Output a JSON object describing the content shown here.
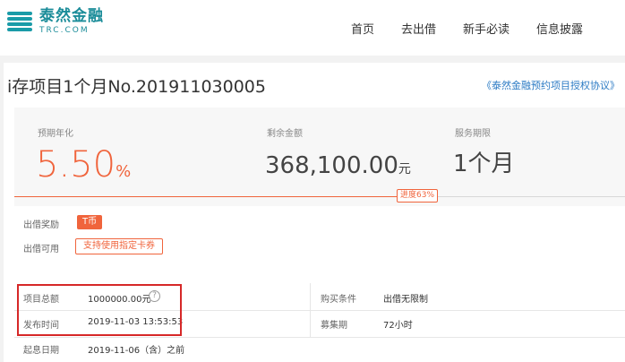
{
  "header": {
    "logo_cn": "泰然金融",
    "logo_en": "TRC.COM",
    "nav": [
      "首页",
      "去出借",
      "新手必读",
      "信息披露"
    ]
  },
  "project": {
    "title": "i存项目1个月No.201911030005",
    "agreement": "《泰然金融预约项目授权协议》"
  },
  "stats": {
    "rate_label": "预期年化",
    "rate_value": "5.50",
    "rate_unit": "%",
    "remaining_label": "剩余金额",
    "remaining_value": "368,100.00",
    "remaining_unit": "元",
    "period_label": "服务期限",
    "period_value": "1个月",
    "progress_text": "进度63%",
    "progress_percent": 63
  },
  "rows": {
    "reward_label": "出借奖励",
    "reward_tag": "T币",
    "usable_label": "出借可用",
    "usable_tag": "支持使用指定卡券"
  },
  "info": {
    "total_label": "项目总额",
    "total_value": "1000000.00元",
    "help_icon": "?",
    "purchase_label": "购买条件",
    "purchase_value": "出借无限制",
    "publish_label": "发布时间",
    "publish_value": "2019-11-03 13:53:53",
    "raise_label": "募集期",
    "raise_value": "72小时",
    "start_label": "起息日期",
    "start_value": "2019-11-06（含）之前"
  },
  "colors": {
    "accent": "#f0643c",
    "brand": "#1a8c99",
    "link": "#2c7bc4",
    "highlight": "#d62828"
  }
}
